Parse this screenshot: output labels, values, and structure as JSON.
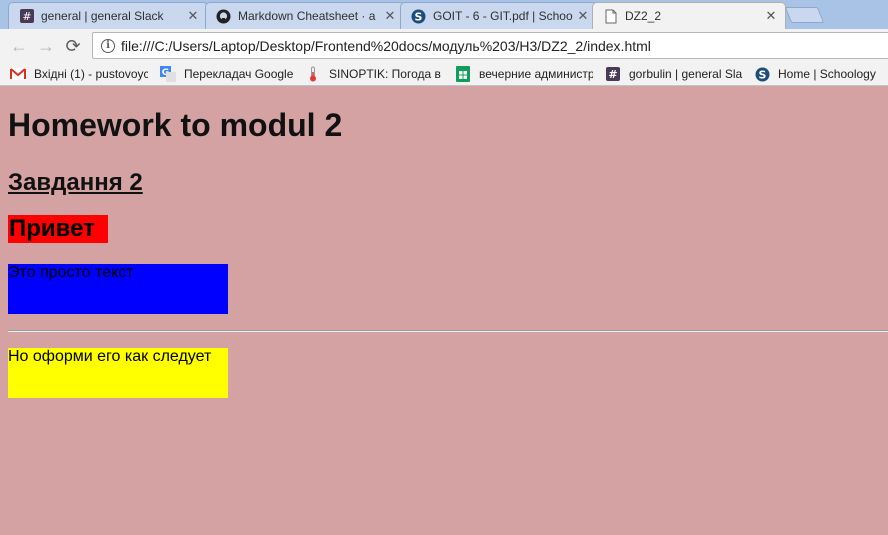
{
  "tabs": [
    {
      "title": "general | general Slack",
      "icon": "slack-hash-icon",
      "close": "✕"
    },
    {
      "title": "Markdown Cheatsheet · a",
      "icon": "github-icon",
      "close": "✕"
    },
    {
      "title": "GOIT - 6 - GIT.pdf | Schoo",
      "icon": "schoology-icon",
      "close": "✕"
    },
    {
      "title": "DZ2_2",
      "icon": "document-icon",
      "close": "✕"
    }
  ],
  "toolbar": {
    "back": "←",
    "forward": "→",
    "reload": "⟳",
    "info": "i",
    "url": "file:///C:/Users/Laptop/Desktop/Frontend%20docs/модуль%203/H3/DZ2_2/index.html"
  },
  "bookmarks": [
    {
      "label": "Вхідні (1) - pustovoyc",
      "icon": "gmail-icon"
    },
    {
      "label": "Перекладач Google",
      "icon": "google-translate-icon"
    },
    {
      "label": "SINOPTIK: Погода в У",
      "icon": "thermometer-icon"
    },
    {
      "label": "вечерние администр",
      "icon": "sheets-icon"
    },
    {
      "label": "gorbulin | general Sla",
      "icon": "slack-hash-icon"
    },
    {
      "label": "Home | Schoology",
      "icon": "schoology-icon"
    }
  ],
  "content": {
    "heading1": "Homework to modul 2",
    "heading2": "Завдання 2",
    "heading3": "Привет",
    "paragraph1": "Это просто текст",
    "paragraph2": "Но оформи его как следует"
  },
  "colors": {
    "page_background": "#d4a2a2",
    "heading3_background": "#ff0000",
    "paragraph1_background": "#0000ff",
    "paragraph2_background": "#ffff00"
  }
}
